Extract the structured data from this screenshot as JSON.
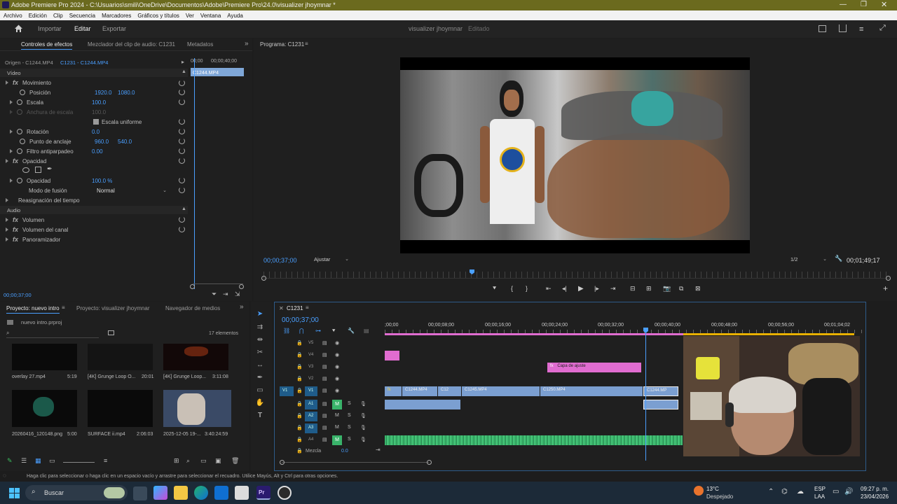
{
  "window": {
    "title": "Adobe Premiere Pro 2024 - C:\\Usuarios\\smili\\OneDrive\\Documentos\\Adobe\\Premiere Pro\\24.0\\visualizer jhoymnar *"
  },
  "menu": [
    "Archivo",
    "Edición",
    "Clip",
    "Secuencia",
    "Marcadores",
    "Gráficos y títulos",
    "Ver",
    "Ventana",
    "Ayuda"
  ],
  "workspace": {
    "tabs": [
      "Importar",
      "Editar",
      "Exportar"
    ],
    "project_name": "visualizer jhoymnar",
    "status": "Editado"
  },
  "effects_panel": {
    "tabs": [
      "Controles de efectos",
      "Mezclador del clip de audio: C1231",
      "Metadatos"
    ],
    "source": "Origen - C1244.MP4",
    "sequence": "C1231 - C1244.MP4",
    "time_start": "00;00",
    "time_end": "00;00;40;00",
    "clip_label": "C1244.MP4",
    "video_header": "Vídeo",
    "motion": "Movimiento",
    "pos_label": "Posición",
    "pos_x": "1920.0",
    "pos_y": "1080.0",
    "scale_label": "Escala",
    "scale_val": "100.0",
    "scale_w_label": "Anchura de escala",
    "scale_w_val": "100.0",
    "uniform_label": "Escala uniforme",
    "rot_label": "Rotación",
    "rot_val": "0.0",
    "anchor_label": "Punto de anclaje",
    "anchor_x": "960.0",
    "anchor_y": "540.0",
    "flicker_label": "Filtro antiparpadeo",
    "flicker_val": "0.00",
    "opacity_header": "Opacidad",
    "opacity_label": "Opacidad",
    "opacity_val": "100.0 %",
    "blend_label": "Modo de fusión",
    "blend_val": "Normal",
    "time_remap": "Reasignación del tiempo",
    "audio_header": "Audio",
    "volume": "Volumen",
    "channel_volume": "Volumen del canal",
    "panner": "Panoramizador",
    "current_time": "00;00;37;00"
  },
  "program_monitor": {
    "title": "Programa: C1231",
    "timecode": "00;00;37;00",
    "fit": "Ajustar",
    "resolution": "1/2",
    "duration": "00;01;49;17"
  },
  "project_panel": {
    "tabs": [
      "Proyecto: nuevo intro",
      "Proyecto: visualizer jhoymnar",
      "Navegador de medios"
    ],
    "file": "nuevo intro.prproj",
    "count": "17 elementos",
    "items": [
      {
        "name": "overlay 27.mp4",
        "dur": "5:19"
      },
      {
        "name": "[4K] Grunge Loop O...",
        "dur": "20:01"
      },
      {
        "name": "[4K] Grunge Loop...",
        "dur": "3:11:08"
      },
      {
        "name": "20260416_120148.png",
        "dur": "5:00"
      },
      {
        "name": "SURFACE ii.mp4",
        "dur": "2:06:03"
      },
      {
        "name": "2025-12-05 19-...",
        "dur": "3:40:24:59"
      }
    ]
  },
  "timeline": {
    "name": "C1231",
    "timecode": "00;00;37;00",
    "ruler": [
      ";00;00",
      "00;00;08;00",
      "00;00;16;00",
      "00;00;24;00",
      "00;00;32;00",
      "00;00;40;00",
      "00;00;48;00",
      "00;00;56;00",
      "00;01;04;02"
    ],
    "video_tracks": [
      "V5",
      "V4",
      "V3",
      "V2",
      "V1"
    ],
    "audio_tracks": [
      "A1",
      "A2",
      "A3",
      "A4"
    ],
    "adjust_clip": "Capa de ajuste",
    "clips": [
      "C1244.MP4",
      "C12",
      "C1245.MP4",
      "C1250.MP4",
      "C1244.MP"
    ],
    "mix_label": "Mezcla",
    "mix_val": "0.0"
  },
  "status_bar": "Haga clic para seleccionar o haga clic en un espacio vacío y arrastre para seleccionar el recuadro. Utilice Mayús, Alt y Ctrl para otras opciones.",
  "taskbar": {
    "search": "Buscar",
    "temp": "13°C",
    "weather": "Despejado",
    "lang1": "ESP",
    "lang2": "LAA",
    "time": "09:27 p. m.",
    "date": "23/04/2026"
  },
  "colors": {
    "accent": "#4a9fff",
    "pink": "#e06cd0",
    "clip_blue": "#7b9fd1",
    "audio_green": "#39b36a",
    "track_blue": "#1f5c8a"
  }
}
